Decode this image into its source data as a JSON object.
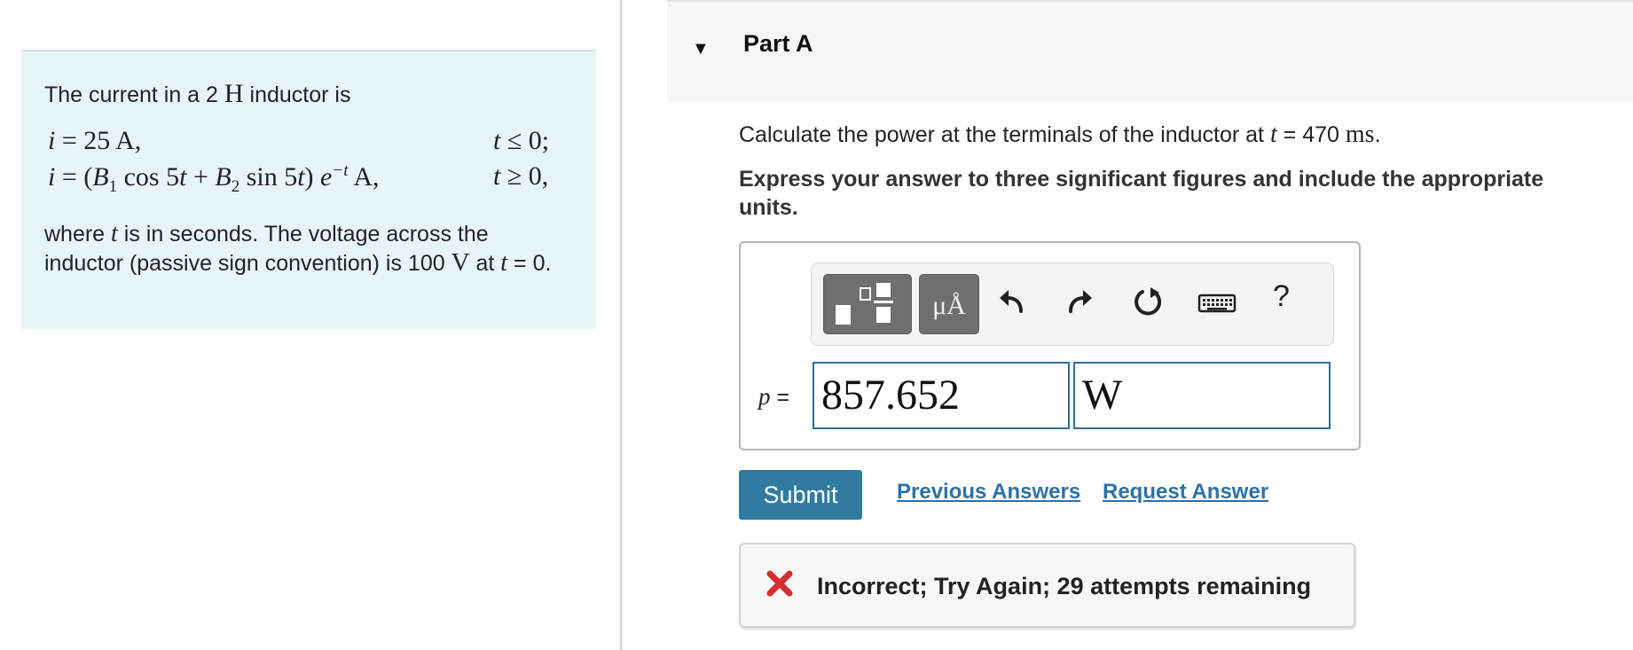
{
  "problem": {
    "intro_prefix": "The current in a 2 ",
    "intro_unit": "H",
    "intro_suffix": " inductor is",
    "eq1_lhs": "i",
    "eq1_rhs": " = 25 A,",
    "eq1_cond_var": "t",
    "eq1_cond_rest": " ≤ 0;",
    "eq2_lhs": "i",
    "eq2_rhs_a": " = (",
    "eq2_B1": "B",
    "eq2_sub1": "1",
    "eq2_cos": " cos 5",
    "eq2_t1": "t",
    "eq2_plus": " + ",
    "eq2_B2": "B",
    "eq2_sub2": "2",
    "eq2_sin": " sin 5",
    "eq2_t2": "t",
    "eq2_close": ") ",
    "eq2_e": "e",
    "eq2_exp": "−t",
    "eq2_unit": " A,",
    "eq2_cond_var": "t",
    "eq2_cond_rest": " ≥ 0,",
    "desc_1": "where ",
    "desc_t": "t",
    "desc_2": " is in seconds. The voltage across the inductor (passive sign convention) is 100 ",
    "desc_V": "V",
    "desc_3": " at ",
    "desc_t2": "t",
    "desc_4": " = 0."
  },
  "part": {
    "title": "Part A",
    "question_1": "Calculate the power at the terminals of the inductor at ",
    "question_t": "t",
    "question_2": " = 470 ",
    "question_unit": "ms",
    "question_3": ".",
    "instruction": "Express your answer to three significant figures and include the appropriate units."
  },
  "toolbar": {
    "units_label": "μÅ",
    "help_label": "?"
  },
  "answer": {
    "variable": "p",
    "equals": " =",
    "value": "857.652",
    "unit": "W"
  },
  "actions": {
    "submit_label": "Submit",
    "previous_answers": "Previous Answers",
    "request_answer": "Request Answer"
  },
  "feedback": {
    "text": "Incorrect; Try Again; 29 attempts remaining",
    "color": "#d62d2d"
  }
}
